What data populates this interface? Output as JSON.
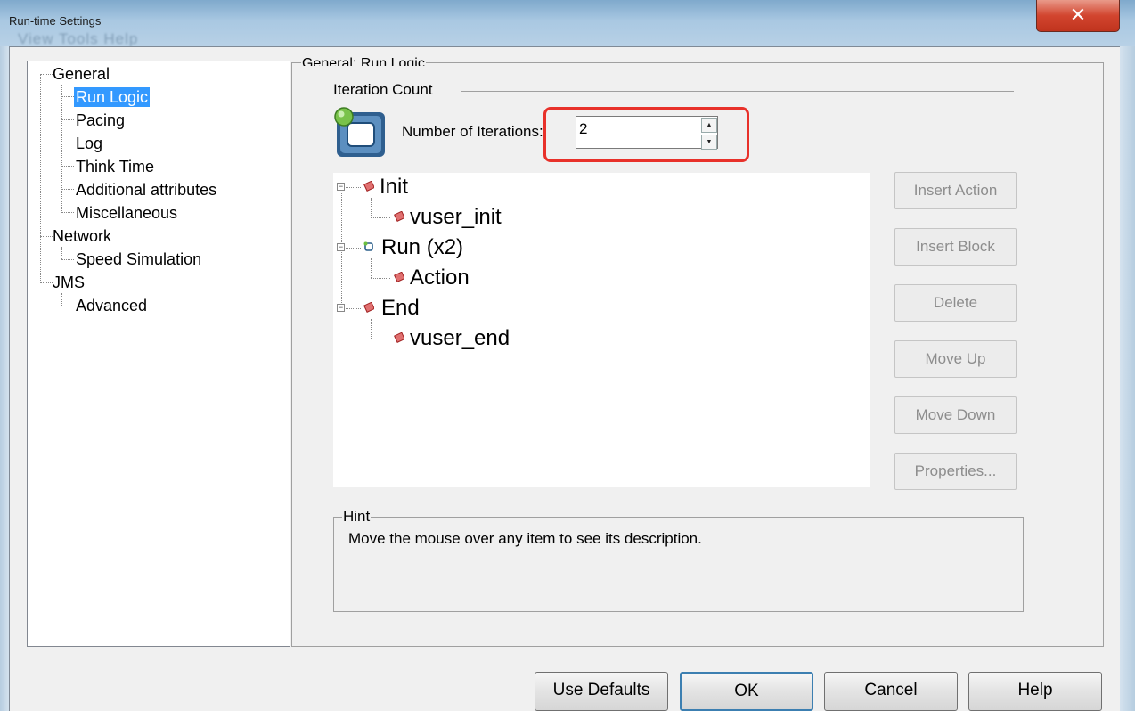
{
  "window": {
    "title": "Run-time Settings",
    "background_menu": "View   Tools   Help",
    "close_label": "✕"
  },
  "tree": {
    "items": [
      {
        "label": "General"
      },
      {
        "label": "Run Logic",
        "selected": true
      },
      {
        "label": "Pacing"
      },
      {
        "label": "Log"
      },
      {
        "label": "Think Time"
      },
      {
        "label": "Additional attributes"
      },
      {
        "label": "Miscellaneous"
      },
      {
        "label": "Network"
      },
      {
        "label": "Speed Simulation"
      },
      {
        "label": "JMS"
      },
      {
        "label": "Advanced"
      }
    ]
  },
  "panel": {
    "title": "General: Run Logic",
    "iteration_count_label": "Iteration Count",
    "number_of_iterations_label": "Number of Iterations:",
    "number_of_iterations_value": "2"
  },
  "action_tree": {
    "nodes": [
      {
        "label": "Init",
        "icon": "block-icon",
        "children": [
          {
            "label": "vuser_init",
            "icon": "action-icon"
          }
        ]
      },
      {
        "label": "Run (x2)",
        "icon": "loop-icon",
        "children": [
          {
            "label": "Action",
            "icon": "action-icon"
          }
        ]
      },
      {
        "label": "End",
        "icon": "block-icon",
        "children": [
          {
            "label": "vuser_end",
            "icon": "action-icon"
          }
        ]
      }
    ]
  },
  "side_buttons": {
    "insert_action": "Insert Action",
    "insert_block": "Insert Block",
    "delete": "Delete",
    "move_up": "Move Up",
    "move_down": "Move Down",
    "properties": "Properties..."
  },
  "hint": {
    "title": "Hint",
    "text": "Move the mouse over any item to see its description."
  },
  "footer": {
    "use_defaults": "Use Defaults",
    "ok": "OK",
    "cancel": "Cancel",
    "help": "Help"
  },
  "colors": {
    "selection": "#3399ff",
    "highlight_box": "#e8312a",
    "close_button": "#d2452f"
  }
}
